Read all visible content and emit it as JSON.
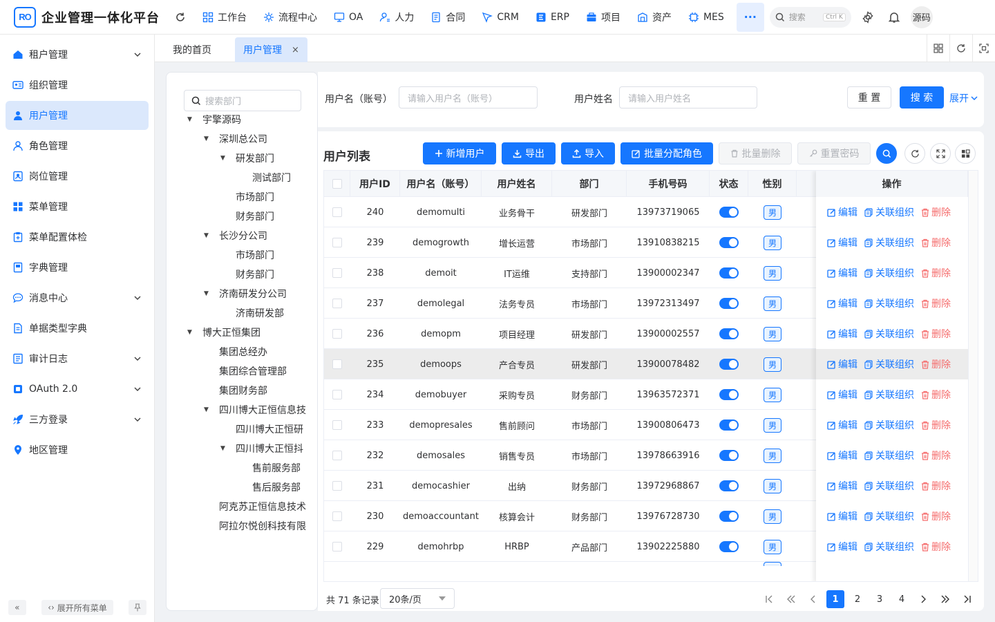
{
  "header": {
    "logo_mark": "RO",
    "app_title": "企业管理一体化平台",
    "apps": [
      "工作台",
      "流程中心",
      "OA",
      "人力",
      "合同",
      "CRM",
      "ERP",
      "项目",
      "资产",
      "MES"
    ],
    "more": "···",
    "search_placeholder": "搜索",
    "search_shortcut": "Ctrl K",
    "user_name": "源码"
  },
  "sidebar": {
    "items": [
      {
        "label": "租户管理",
        "icon": "home-icon",
        "expandable": true
      },
      {
        "label": "组织管理",
        "icon": "id-card-icon",
        "expandable": false
      },
      {
        "label": "用户管理",
        "icon": "user-icon",
        "expandable": false,
        "active": true
      },
      {
        "label": "角色管理",
        "icon": "user-outline-icon",
        "expandable": false
      },
      {
        "label": "岗位管理",
        "icon": "badge-icon",
        "expandable": false
      },
      {
        "label": "菜单管理",
        "icon": "grid-icon",
        "expandable": false
      },
      {
        "label": "菜单配置体检",
        "icon": "clipboard-icon",
        "expandable": false
      },
      {
        "label": "字典管理",
        "icon": "book-icon",
        "expandable": false
      },
      {
        "label": "消息中心",
        "icon": "chat-icon",
        "expandable": true
      },
      {
        "label": "单据类型字典",
        "icon": "doc-icon",
        "expandable": false
      },
      {
        "label": "审计日志",
        "icon": "log-icon",
        "expandable": true
      },
      {
        "label": "OAuth 2.0",
        "icon": "square-icon",
        "expandable": true
      },
      {
        "label": "三方登录",
        "icon": "rocket-icon",
        "expandable": true
      },
      {
        "label": "地区管理",
        "icon": "pin-icon",
        "expandable": false
      }
    ],
    "expand_all": "展开所有菜单"
  },
  "tabs": [
    {
      "label": "我的首页",
      "active": false
    },
    {
      "label": "用户管理",
      "active": true,
      "close": "×"
    }
  ],
  "tree": {
    "search_placeholder": "搜索部门",
    "nodes": [
      {
        "label": "宇擎源码",
        "level": 0,
        "expanded": true
      },
      {
        "label": "深圳总公司",
        "level": 1,
        "expanded": true
      },
      {
        "label": "研发部门",
        "level": 2,
        "expanded": true
      },
      {
        "label": "测试部门",
        "level": 3
      },
      {
        "label": "市场部门",
        "level": 2
      },
      {
        "label": "财务部门",
        "level": 2
      },
      {
        "label": "长沙分公司",
        "level": 1,
        "expanded": true
      },
      {
        "label": "市场部门",
        "level": 2
      },
      {
        "label": "财务部门",
        "level": 2
      },
      {
        "label": "济南研发分公司",
        "level": 1,
        "expanded": true
      },
      {
        "label": "济南研发部",
        "level": 2
      },
      {
        "label": "博大正恒集团",
        "level": 0,
        "expanded": true
      },
      {
        "label": "集团总经办",
        "level": 1
      },
      {
        "label": "集团综合管理部",
        "level": 1
      },
      {
        "label": "集团财务部",
        "level": 1
      },
      {
        "label": "四川博大正恒信息技",
        "level": 1,
        "expanded": true
      },
      {
        "label": "四川博大正恒研",
        "level": 2
      },
      {
        "label": "四川博大正恒抖",
        "level": 2,
        "expanded": true
      },
      {
        "label": "售前服务部",
        "level": 3
      },
      {
        "label": "售后服务部",
        "level": 3
      },
      {
        "label": "阿克苏正恒信息技术",
        "level": 1
      },
      {
        "label": "阿拉尔悦创科技有限",
        "level": 1
      }
    ]
  },
  "search_form": {
    "username_label": "用户名（账号）",
    "username_placeholder": "请输入用户名（账号）",
    "name_label": "用户姓名",
    "name_placeholder": "请输入用户姓名",
    "reset": "重 置",
    "search": "搜 索",
    "expand": "展开"
  },
  "table": {
    "title": "用户列表",
    "buttons": {
      "add": "新增用户",
      "export": "导出",
      "import": "导入",
      "assign_roles": "批量分配角色",
      "batch_delete": "批量删除",
      "reset_password": "重置密码"
    },
    "columns": [
      "用户ID",
      "用户名（账号）",
      "用户姓名",
      "部门",
      "手机号码",
      "状态",
      "性别",
      "操作"
    ],
    "actions": {
      "edit": "编辑",
      "link_org": "关联组织",
      "delete": "删除"
    },
    "rows": [
      {
        "id": "240",
        "username": "demomulti",
        "name": "业务骨干",
        "dept": "研发部门",
        "phone": "13973719065",
        "enabled": true,
        "gender": "男"
      },
      {
        "id": "239",
        "username": "demogrowth",
        "name": "增长运营",
        "dept": "市场部门",
        "phone": "13910838215",
        "enabled": true,
        "gender": "男"
      },
      {
        "id": "238",
        "username": "demoit",
        "name": "IT运维",
        "dept": "支持部门",
        "phone": "13900002347",
        "enabled": true,
        "gender": "男"
      },
      {
        "id": "237",
        "username": "demolegal",
        "name": "法务专员",
        "dept": "市场部门",
        "phone": "13972313497",
        "enabled": true,
        "gender": "男"
      },
      {
        "id": "236",
        "username": "demopm",
        "name": "项目经理",
        "dept": "研发部门",
        "phone": "13900002557",
        "enabled": true,
        "gender": "男"
      },
      {
        "id": "235",
        "username": "demoops",
        "name": "产合专员",
        "dept": "研发部门",
        "phone": "13900078482",
        "enabled": true,
        "gender": "男",
        "highlight": true
      },
      {
        "id": "234",
        "username": "demobuyer",
        "name": "采购专员",
        "dept": "财务部门",
        "phone": "13963572371",
        "enabled": true,
        "gender": "男"
      },
      {
        "id": "233",
        "username": "demopresales",
        "name": "售前顾问",
        "dept": "市场部门",
        "phone": "13900806473",
        "enabled": true,
        "gender": "男"
      },
      {
        "id": "232",
        "username": "demosales",
        "name": "销售专员",
        "dept": "市场部门",
        "phone": "13978663916",
        "enabled": true,
        "gender": "男"
      },
      {
        "id": "231",
        "username": "democashier",
        "name": "出纳",
        "dept": "财务部门",
        "phone": "13972968867",
        "enabled": true,
        "gender": "男"
      },
      {
        "id": "230",
        "username": "demoaccountant",
        "name": "核算会计",
        "dept": "财务部门",
        "phone": "13976728730",
        "enabled": true,
        "gender": "男"
      },
      {
        "id": "229",
        "username": "demohrbp",
        "name": "HRBP",
        "dept": "产品部门",
        "phone": "13902225880",
        "enabled": true,
        "gender": "男"
      }
    ]
  },
  "pagination": {
    "total_text": "共 71 条记录",
    "page_size": "20条/页",
    "pages": [
      "1",
      "2",
      "3",
      "4"
    ],
    "current": "1"
  },
  "colors": {
    "primary": "#1677ff",
    "danger": "#f56c6c",
    "active_bg": "#dbe8fc"
  }
}
